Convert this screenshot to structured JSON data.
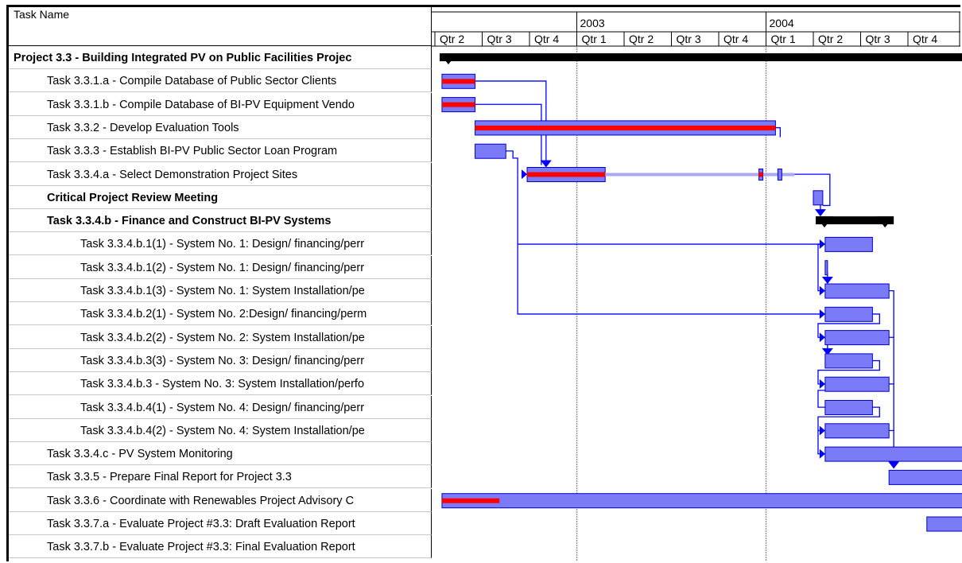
{
  "table": {
    "header": "Task Name",
    "rows": [
      {
        "name": "Project 3.3 - Building Integrated PV on Public Facilities Projec",
        "level": 0,
        "bold": true
      },
      {
        "name": "Task 3.3.1.a - Compile Database of Public Sector Clients",
        "level": 1,
        "bold": false
      },
      {
        "name": "Task 3.3.1.b - Compile Database of BI-PV Equipment Vendo",
        "level": 1,
        "bold": false
      },
      {
        "name": "Task 3.3.2 - Develop Evaluation Tools",
        "level": 1,
        "bold": false
      },
      {
        "name": "Task 3.3.3 - Establish BI-PV Public Sector Loan Program",
        "level": 1,
        "bold": false
      },
      {
        "name": "Task 3.3.4.a - Select Demonstration Project Sites",
        "level": 1,
        "bold": false
      },
      {
        "name": "Critical Project Review Meeting",
        "level": 1,
        "bold": true
      },
      {
        "name": "Task 3.3.4.b - Finance and Construct BI-PV Systems",
        "level": 1,
        "bold": true
      },
      {
        "name": "Task 3.3.4.b.1(1) - System No. 1: Design/ financing/perr",
        "level": 2,
        "bold": false
      },
      {
        "name": "Task 3.3.4.b.1(2) - System No. 1: Design/ financing/perr",
        "level": 2,
        "bold": false
      },
      {
        "name": "Task 3.3.4.b.1(3) - System No. 1: System Installation/pe",
        "level": 2,
        "bold": false
      },
      {
        "name": "Task 3.3.4.b.2(1) - System No. 2:Design/ financing/perm",
        "level": 2,
        "bold": false
      },
      {
        "name": "Task 3.3.4.b.2(2) - System No. 2: System Installation/pe",
        "level": 2,
        "bold": false
      },
      {
        "name": "Task 3.3.4.b.3(3) - System No. 3: Design/ financing/perr",
        "level": 2,
        "bold": false
      },
      {
        "name": "Task 3.3.4.b.3 - System No. 3: System Installation/perfo",
        "level": 2,
        "bold": false
      },
      {
        "name": "Task 3.3.4.b.4(1) - System No. 4: Design/ financing/perr",
        "level": 2,
        "bold": false
      },
      {
        "name": "Task 3.3.4.b.4(2) - System No. 4: System Installation/pe",
        "level": 2,
        "bold": false
      },
      {
        "name": "Task 3.3.4.c - PV System Monitoring",
        "level": 1,
        "bold": false
      },
      {
        "name": "Task 3.3.5 - Prepare Final Report for Project 3.3",
        "level": 1,
        "bold": false
      },
      {
        "name": "Task 3.3.6 - Coordinate with Renewables Project Advisory C",
        "level": 1,
        "bold": false
      },
      {
        "name": "Task 3.3.7.a - Evaluate Project #3.3: Draft Evaluation Report",
        "level": 1,
        "bold": false
      },
      {
        "name": "Task 3.3.7.b - Evaluate Project #3.3: Final Evaluation Report",
        "level": 1,
        "bold": false
      }
    ]
  },
  "chart_data": {
    "type": "gantt",
    "x_unit": "quarter",
    "x_start": "2002-Q2",
    "years": [
      "2003",
      "2004"
    ],
    "quarters": [
      "Qtr 2",
      "Qtr 3",
      "Qtr 4",
      "Qtr 1",
      "Qtr 2",
      "Qtr 3",
      "Qtr 4",
      "Qtr 1",
      "Qtr 2",
      "Qtr 3",
      "Qtr 4"
    ],
    "colors": {
      "task": "#7b7bf7",
      "task_border": "#0000d0",
      "progress": "#ff0000",
      "summary": "#000000",
      "link": "#0000ff",
      "split": "#a9a9f5"
    },
    "tasks": [
      {
        "row": 0,
        "kind": "summary",
        "start": 0.1,
        "end": 11.2,
        "progress": 0
      },
      {
        "row": 1,
        "kind": "task",
        "start": 0.15,
        "end": 0.85,
        "progress": 1.0
      },
      {
        "row": 2,
        "kind": "task",
        "start": 0.15,
        "end": 0.85,
        "progress": 1.0
      },
      {
        "row": 3,
        "kind": "task",
        "start": 0.85,
        "end": 7.2,
        "progress": 1.0
      },
      {
        "row": 4,
        "kind": "task",
        "start": 0.85,
        "end": 1.5,
        "progress": 0
      },
      {
        "row": 5,
        "kind": "task",
        "start": 1.95,
        "end": 3.6,
        "progress": 1.0,
        "split_end": 7.6,
        "markers": [
          6.85,
          7.25
        ]
      },
      {
        "row": 6,
        "kind": "milestone-bar",
        "start": 8.0,
        "end": 8.2,
        "progress": 0
      },
      {
        "row": 7,
        "kind": "summary",
        "start": 8.05,
        "end": 9.7,
        "progress": 0
      },
      {
        "row": 8,
        "kind": "task",
        "start": 8.25,
        "end": 9.25,
        "progress": 0
      },
      {
        "row": 9,
        "kind": "task",
        "start": 8.25,
        "end": 8.3,
        "progress": 0
      },
      {
        "row": 10,
        "kind": "task",
        "start": 8.25,
        "end": 9.6,
        "progress": 0
      },
      {
        "row": 11,
        "kind": "task",
        "start": 8.25,
        "end": 9.25,
        "progress": 0
      },
      {
        "row": 12,
        "kind": "task",
        "start": 8.25,
        "end": 9.6,
        "progress": 0
      },
      {
        "row": 13,
        "kind": "task",
        "start": 8.25,
        "end": 9.25,
        "progress": 0
      },
      {
        "row": 14,
        "kind": "task",
        "start": 8.25,
        "end": 9.6,
        "progress": 0
      },
      {
        "row": 15,
        "kind": "task",
        "start": 8.25,
        "end": 9.25,
        "progress": 0
      },
      {
        "row": 16,
        "kind": "task",
        "start": 8.25,
        "end": 9.6,
        "progress": 0
      },
      {
        "row": 17,
        "kind": "task",
        "start": 8.25,
        "end": 11.2,
        "progress": 0
      },
      {
        "row": 18,
        "kind": "task",
        "start": 9.6,
        "end": 11.2,
        "progress": 0
      },
      {
        "row": 19,
        "kind": "task",
        "start": 0.15,
        "end": 11.2,
        "progress": 0.11
      },
      {
        "row": 20,
        "kind": "task",
        "start": 10.4,
        "end": 11.2,
        "progress": 0
      },
      {
        "row": 21,
        "kind": "none",
        "start": 0,
        "end": 0,
        "progress": 0
      }
    ]
  }
}
